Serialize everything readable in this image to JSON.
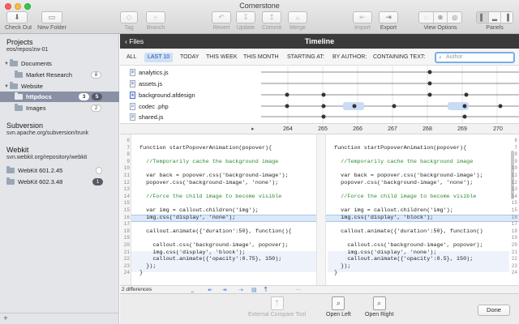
{
  "window": {
    "title": "Cornerstone"
  },
  "toolbar": {
    "checkout": "Check Out",
    "new_folder": "New Folder",
    "tag": "Tag",
    "branch": "Branch",
    "revert": "Revert",
    "update": "Update",
    "commit": "Commit",
    "merge": "Merge",
    "import": "Import",
    "export": "Export",
    "view_options": "View Options",
    "panels": "Panels"
  },
  "sidebar": {
    "projects_title": "Projects",
    "projects_path": "eos/repos/zw-01",
    "tree": [
      {
        "label": "Documents",
        "level": 1,
        "expanded": true
      },
      {
        "label": "Market Research",
        "level": 2,
        "badge": "8"
      },
      {
        "label": "Website",
        "level": 1,
        "expanded": true
      },
      {
        "label": "httpdocs",
        "level": 2,
        "badge_a": "3",
        "badge_b": "5",
        "selected": true
      },
      {
        "label": "Images",
        "level": 2,
        "badge": "2"
      }
    ],
    "subversion_title": "Subversion",
    "subversion_path": "svn.apache.org/subversion/trunk",
    "webkit_title": "Webkit",
    "webkit_path": "svn.webkit.org/repository/webkit",
    "webkit_items": [
      {
        "label": "WebKit 601.2.45",
        "badge": ""
      },
      {
        "label": "WebKit 602.3.48",
        "badge": "1"
      }
    ],
    "add_symbol": "+"
  },
  "timeline": {
    "back_label": "Files",
    "title": "Timeline",
    "filters": [
      "ALL",
      "LAST 10",
      "TODAY",
      "THIS WEEK",
      "THIS MONTH",
      "STARTING AT:",
      "BY AUTHOR:",
      "CONTAINING TEXT:"
    ],
    "active_filter": "LAST 10",
    "author_placeholder": "Author",
    "files": [
      "analytics.js",
      "assets.js",
      "background.afdesign",
      "codec .php",
      "shared.js"
    ],
    "columns": [
      "264",
      "265",
      "266",
      "267",
      "268",
      "269",
      "270"
    ]
  },
  "diff": {
    "left_lines": [
      {
        "n": "6",
        "text": ""
      },
      {
        "n": "7",
        "text": "function startPopoverAnimation(popover){"
      },
      {
        "n": "8",
        "text": ""
      },
      {
        "n": "9",
        "text": "  //Temporarily cache the background image"
      },
      {
        "n": "10",
        "text": ""
      },
      {
        "n": "11",
        "text": "  var back = popover.css('background-image');"
      },
      {
        "n": "12",
        "text": "  popover.css('background-image', 'none');"
      },
      {
        "n": "13",
        "text": ""
      },
      {
        "n": "14",
        "text": "  //Force the child image to become visible"
      },
      {
        "n": "15",
        "text": ""
      },
      {
        "n": "15",
        "text": "  var img = callout.children('img');"
      },
      {
        "n": "16",
        "text": "  img.css('display', 'none');"
      },
      {
        "n": "17",
        "text": ""
      },
      {
        "n": "18",
        "text": "  callout.animate({'duration':50}, function(){"
      },
      {
        "n": "19",
        "text": ""
      },
      {
        "n": "20",
        "text": "    callout.css('background-image', popover);"
      },
      {
        "n": "21",
        "text": "    img.css('display', 'block');"
      },
      {
        "n": "22",
        "text": "    callout.animate({'opacity':0.75}, 150);"
      },
      {
        "n": "23",
        "text": "  });"
      },
      {
        "n": "24",
        "text": "}"
      }
    ],
    "right_lines": [
      {
        "n": "6",
        "text": ""
      },
      {
        "n": "7",
        "text": "function startPopoverAnimation(popover){"
      },
      {
        "n": "8",
        "text": ""
      },
      {
        "n": "9",
        "text": "  //Temporarily cache the background image"
      },
      {
        "n": "10",
        "text": ""
      },
      {
        "n": "11",
        "text": "  var back = popover.css('background-image');"
      },
      {
        "n": "12",
        "text": "  popover.css('background-image', 'none');"
      },
      {
        "n": "13",
        "text": ""
      },
      {
        "n": "14",
        "text": "  //Force the child image to become visible"
      },
      {
        "n": "15",
        "text": ""
      },
      {
        "n": "15",
        "text": "  var img = callout.children('img');"
      },
      {
        "n": "16",
        "text": "  img.css('display', 'block');"
      },
      {
        "n": "17",
        "text": ""
      },
      {
        "n": "18",
        "text": "  callout.animate({'duration':50}, function()"
      },
      {
        "n": "19",
        "text": ""
      },
      {
        "n": "20",
        "text": "    callout.css('background-image', popover);"
      },
      {
        "n": "21",
        "text": "    img.css('display', 'none');"
      },
      {
        "n": "22",
        "text": "    callout.animate({'opacity':0.5}, 150);"
      },
      {
        "n": "23",
        "text": "  });"
      },
      {
        "n": "24",
        "text": "}"
      }
    ],
    "status": "2 differences"
  },
  "bottom": {
    "external_compare": "External Compare Tool",
    "open_left": "Open Left",
    "open_right": "Open Right",
    "done": "Done"
  },
  "colors": {
    "accent": "#1a4f9c",
    "selection": "#8a91a6",
    "header_dark": "#3a3a3a",
    "diff_highlight": "#dbe8f8"
  }
}
